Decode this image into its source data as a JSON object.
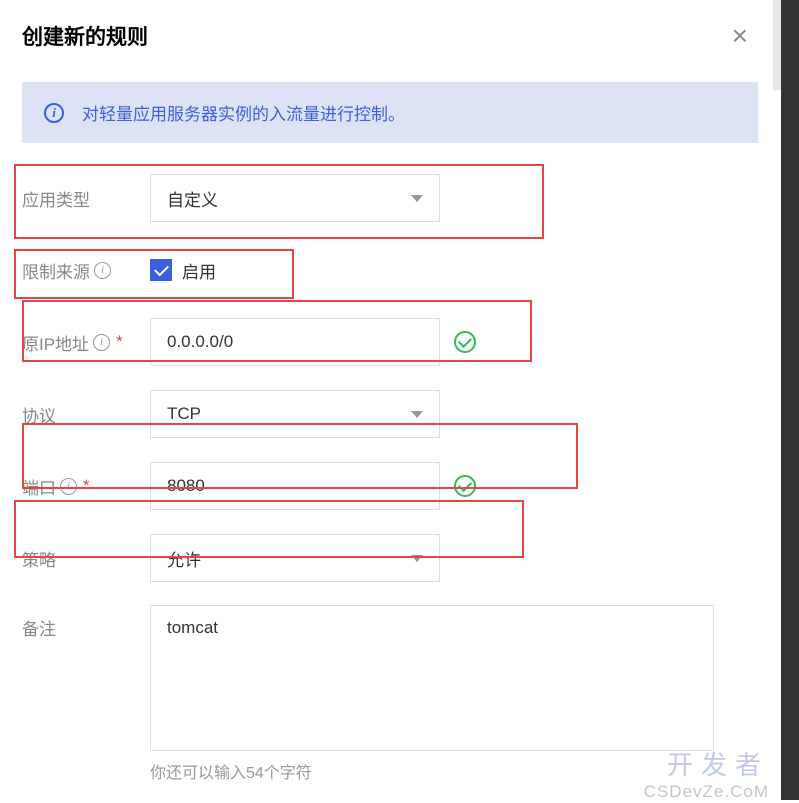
{
  "modal": {
    "title": "创建新的规则",
    "close_label": "×"
  },
  "banner": {
    "text": "对轻量应用服务器实例的入流量进行控制。"
  },
  "fields": {
    "app_type": {
      "label": "应用类型",
      "value": "自定义"
    },
    "restrict_source": {
      "label": "限制来源",
      "checkbox_label": "启用"
    },
    "source_ip": {
      "label": "原IP地址",
      "value": "0.0.0.0/0"
    },
    "protocol": {
      "label": "协议",
      "value": "TCP"
    },
    "port": {
      "label": "端口",
      "value": "8080"
    },
    "policy": {
      "label": "策略",
      "value": "允许"
    },
    "remark": {
      "label": "备注",
      "value": "tomcat",
      "hint": "你还可以输入54个字符"
    }
  },
  "watermark": {
    "main": "开发者",
    "sub": "CSDevZe.CoM"
  }
}
